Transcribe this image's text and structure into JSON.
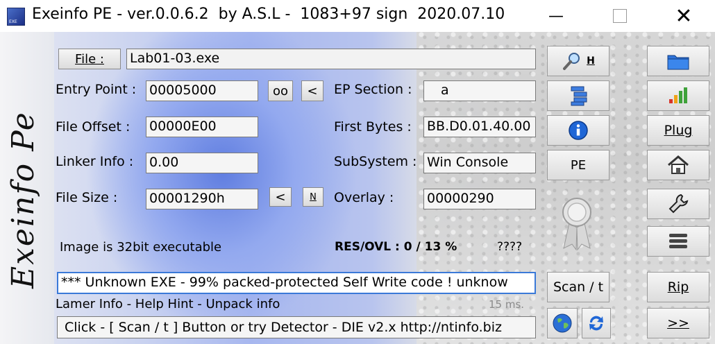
{
  "window": {
    "title": "Exeinfo PE - ver.0.0.6.2  by A.S.L -  1083+97 sign  2020.07.10",
    "icon_label": "EXE",
    "minimize": "—",
    "close": "✕"
  },
  "brand": "Exeinfo  Pe",
  "file": {
    "button_label": "File :",
    "value": "Lab01-03.exe"
  },
  "entry_point": {
    "label": "Entry Point :",
    "value": "00005000",
    "btn_oo": "oo",
    "btn_lt": "<"
  },
  "ep_section": {
    "label": "EP Section :",
    "value": "a"
  },
  "file_offset": {
    "label": "File Offset :",
    "value": "00000E00"
  },
  "first_bytes": {
    "label": "First Bytes :",
    "value": "BB.D0.01.40.00"
  },
  "linker_info": {
    "label": "Linker Info :",
    "value": "0.00"
  },
  "subsystem": {
    "label": "SubSystem :",
    "value": "Win Console"
  },
  "file_size": {
    "label": "File Size :",
    "value": "00001290h",
    "btn_lt": "<",
    "btn_n": "N"
  },
  "overlay": {
    "label": "Overlay :",
    "value": "00000290"
  },
  "image_info": "Image is 32bit executable",
  "res_ovl": "RES/OVL : 0 / 13 %",
  "unknown_marks": "????",
  "detection": "*** Unknown EXE  - 99% packed-protected   Self Write code ! unknow",
  "hint": {
    "text": "Lamer Info - Help Hint - Unpack info",
    "time": "15 ms."
  },
  "status": "Click - [ Scan / t ]  Button  or  try Detector - DIE v2.x  http://ntinfo.biz",
  "buttons": {
    "search_h": "H",
    "pe": "PE",
    "scan": "Scan / t",
    "plug": "Plug",
    "rip": "Rip",
    "next": ">>"
  },
  "icons": {
    "search": "magnifier-icon",
    "list": "list-tree-icon",
    "info": "info-icon",
    "medal": "medal-icon",
    "globe": "globe-icon",
    "refresh": "refresh-icon",
    "folder": "folder-icon",
    "bars": "signal-bars-icon",
    "home": "home-icon",
    "wrench": "wrench-icon",
    "menu": "menu-icon"
  }
}
